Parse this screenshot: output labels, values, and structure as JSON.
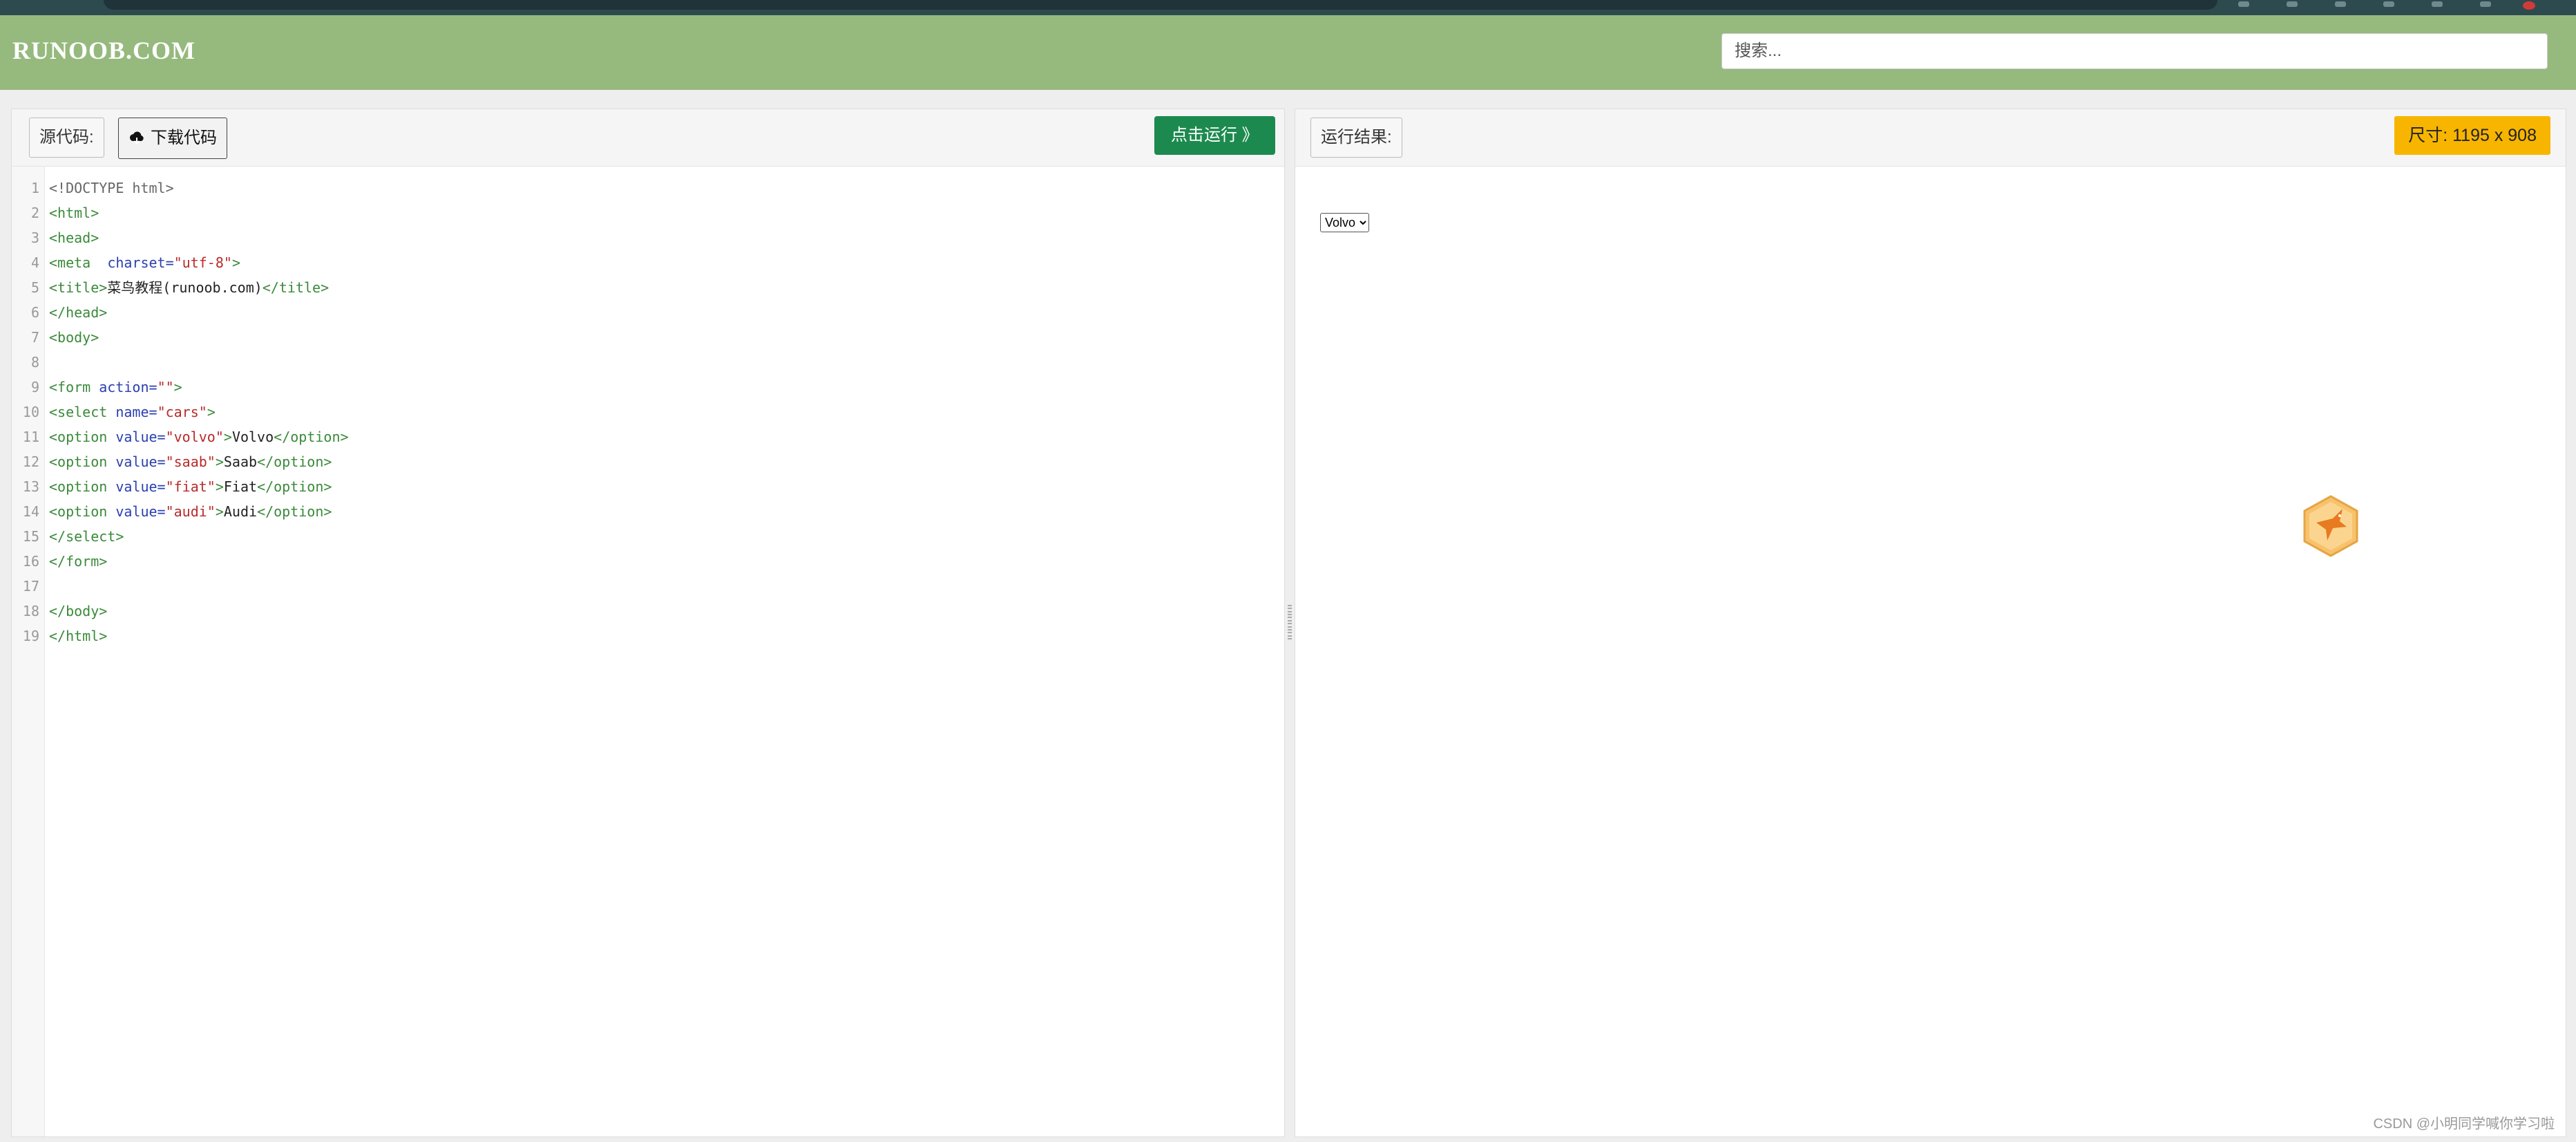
{
  "header": {
    "logo": "RUNOOB.COM",
    "search_placeholder": "搜索..."
  },
  "left_panel": {
    "source_label": "源代码:",
    "download_label": "下载代码",
    "download_icon": "cloud-download-icon",
    "run_label": "点击运行 》"
  },
  "code": {
    "lines": [
      {
        "n": "1",
        "text": "<!DOCTYPE html>"
      },
      {
        "n": "2",
        "text": "<html>"
      },
      {
        "n": "3",
        "text": "<head>"
      },
      {
        "n": "4",
        "text": "<meta  charset=\"utf-8\">"
      },
      {
        "n": "5",
        "text": "<title>菜鸟教程(runoob.com)</title>"
      },
      {
        "n": "6",
        "text": "</head>"
      },
      {
        "n": "7",
        "text": "<body>"
      },
      {
        "n": "8",
        "text": ""
      },
      {
        "n": "9",
        "text": "<form action=\"\">"
      },
      {
        "n": "10",
        "text": "<select name=\"cars\">"
      },
      {
        "n": "11",
        "text": "<option value=\"volvo\">Volvo</option>"
      },
      {
        "n": "12",
        "text": "<option value=\"saab\">Saab</option>"
      },
      {
        "n": "13",
        "text": "<option value=\"fiat\">Fiat</option>"
      },
      {
        "n": "14",
        "text": "<option value=\"audi\">Audi</option>"
      },
      {
        "n": "15",
        "text": "</select>"
      },
      {
        "n": "16",
        "text": "</form>"
      },
      {
        "n": "17",
        "text": ""
      },
      {
        "n": "18",
        "text": "</body>"
      },
      {
        "n": "19",
        "text": "</html>"
      }
    ]
  },
  "right_panel": {
    "result_label": "运行结果:",
    "size_badge": "尺寸: 1195 x 908",
    "demo_select_value": "Volvo"
  },
  "watermark": "CSDN @小明同学喊你学习啦",
  "colors": {
    "header_bg": "#96b97e",
    "run_button": "#1c8a4f",
    "size_badge": "#f7b500",
    "tag": "#3a8a3a",
    "attr": "#2a3fb0",
    "string": "#b82a2a"
  }
}
